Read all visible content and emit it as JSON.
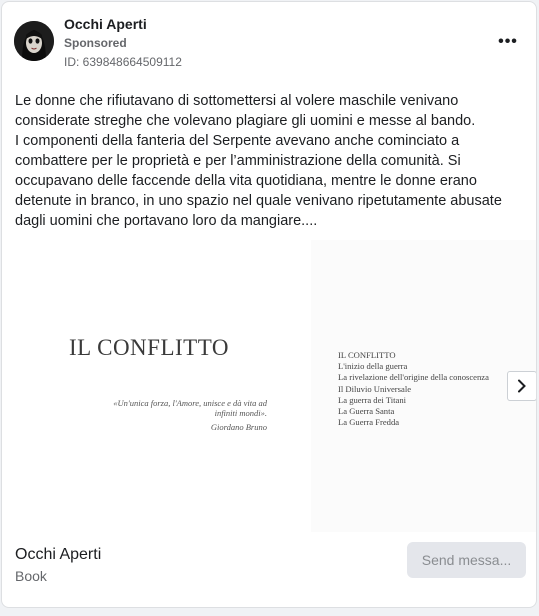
{
  "header": {
    "page_name": "Occhi Aperti",
    "sponsored": "Sponsored",
    "ad_id": "ID: 639848664509112",
    "more_label": "•••"
  },
  "post": {
    "text": "Le donne che rifiutavano di sottomettersi al volere maschile venivano considerate streghe che volevano plagiare gli uomini e messe al bando.\nI componenti della fanteria del Serpente avevano anche cominciato a combattere per le proprietà e per l’amministrazione della comunità. Si occupavano delle faccende della vita quotidiana, mentre le donne erano detenute in branco, in uno spazio nel quale venivano ripetutamente abusate dagli uomini che portavano loro da mangiare...."
  },
  "carousel": {
    "slide1": {
      "title": "IL CONFLITTO",
      "quote": "«Un'unica forza, l'Amore, unisce e dà vita ad infiniti mondi».",
      "quote_author": "Giordano Bruno"
    },
    "slide2": {
      "toc": [
        "IL CONFLITTO",
        "L'inizio della guerra",
        "La rivelazione dell'origine della conoscenza",
        "Il Diluvio Universale",
        "La guerra dei Titani",
        "La Guerra Santa",
        "La Guerra Fredda"
      ]
    },
    "next_icon": "chevron-right-icon"
  },
  "footer": {
    "name": "Occhi Aperti",
    "category": "Book",
    "send_label": "Send messa..."
  },
  "colors": {
    "text_primary": "#1c1e21",
    "text_secondary": "#65676b",
    "button_bg": "#e4e6eb"
  }
}
